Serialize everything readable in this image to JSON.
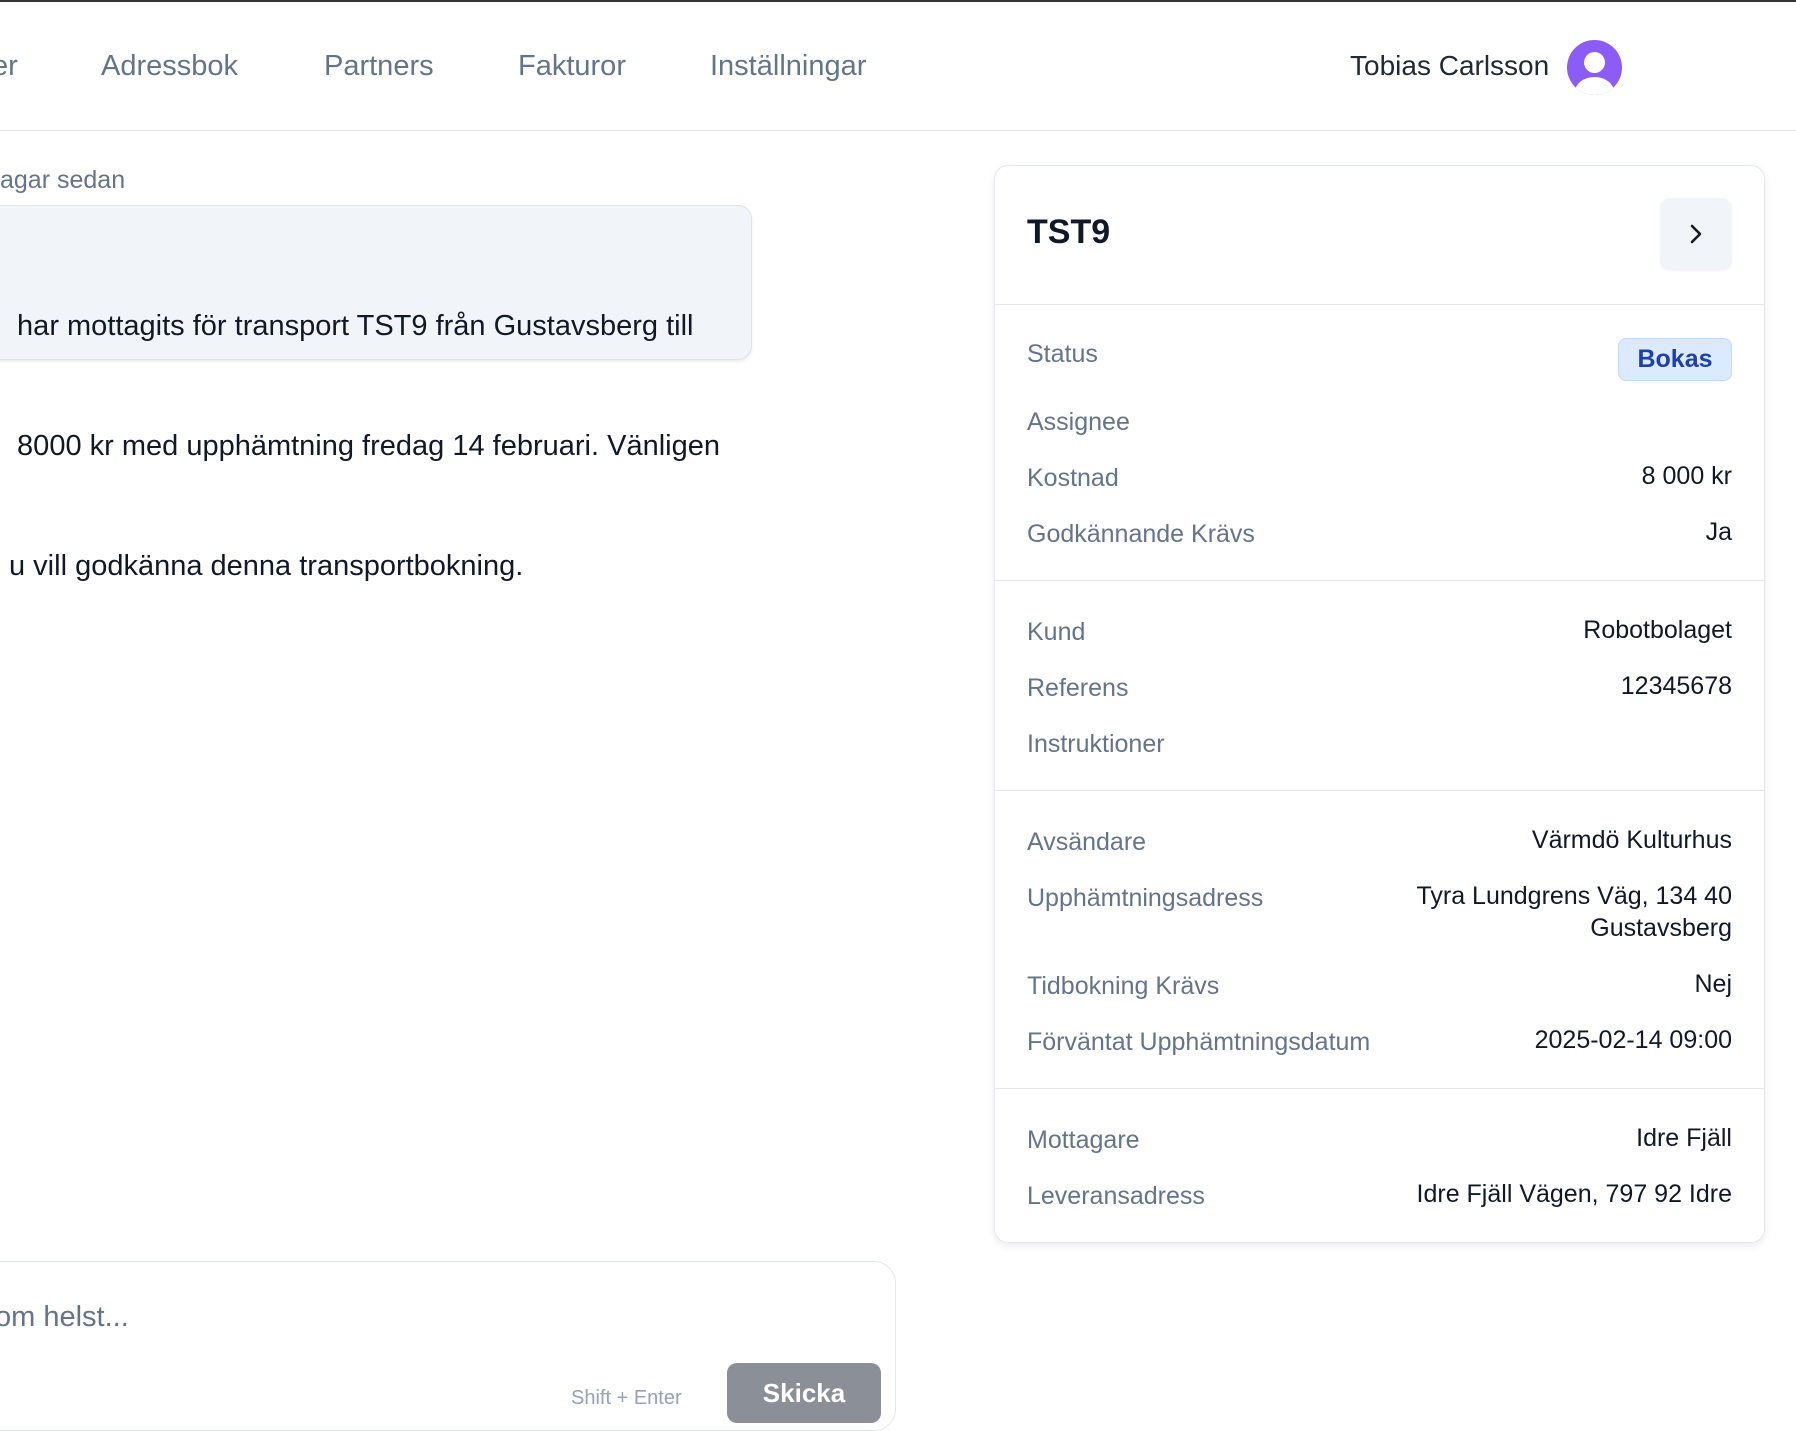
{
  "nav": {
    "items": [
      {
        "label": "er"
      },
      {
        "label": "Adressbok"
      },
      {
        "label": "Partners"
      },
      {
        "label": "Fakturor"
      },
      {
        "label": "Inställningar"
      }
    ],
    "user_name": "Tobias Carlsson"
  },
  "chat": {
    "timestamp": "agar sedan",
    "message_line_1": " har mottagits för transport TST9 från Gustavsberg till",
    "message_line_2": " 8000 kr med upphämtning fredag 14 februari. Vänligen",
    "message_line_3": "u vill godkänna denna transportbokning.",
    "input_placeholder": "om helst...",
    "hint": "Shift + Enter",
    "send_label": "Skicka"
  },
  "panel": {
    "title": "TST9",
    "status_label": "Status",
    "status_value": "Bokas",
    "assignee_label": "Assignee",
    "cost_label": "Kostnad",
    "cost_value": "8 000 kr",
    "approval_label": "Godkännande Krävs",
    "approval_value": "Ja",
    "customer_label": "Kund",
    "customer_value": "Robotbolaget",
    "reference_label": "Referens",
    "reference_value": "12345678",
    "instructions_label": "Instruktioner",
    "sender_label": "Avsändare",
    "sender_value": "Värmdö Kulturhus",
    "pickup_address_label": "Upphämtningsadress",
    "pickup_address_line_1": "Tyra Lundgrens Väg, 134 40",
    "pickup_address_line_2": "Gustavsberg",
    "time_booking_label": "Tidbokning Krävs",
    "time_booking_value": "Nej",
    "expected_pickup_label": "Förväntat Upphämtningsdatum",
    "expected_pickup_value": "2025-02-14 09:00",
    "recipient_label": "Mottagare",
    "recipient_value": "Idre Fjäll",
    "delivery_address_label": "Leveransadress",
    "delivery_address_value": "Idre Fjäll Vägen, 797 92 Idre"
  },
  "colors": {
    "accent": "#8b5cf6",
    "badge_bg": "#dbeafe",
    "badge_text": "#1e40af",
    "muted_text": "#64748b"
  },
  "icons": {
    "avatar": "user-avatar-icon",
    "open": "chevron-right-icon"
  }
}
